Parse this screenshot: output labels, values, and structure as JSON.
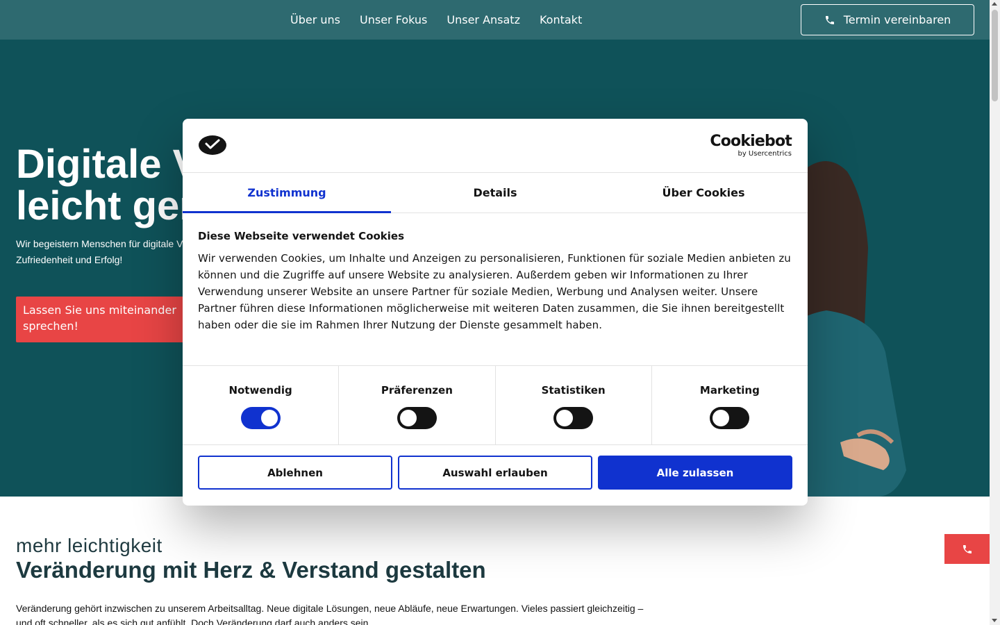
{
  "nav": {
    "items": [
      "Über uns",
      "Unser Fokus",
      "Unser Ansatz",
      "Kontakt"
    ],
    "cta": "Termin vereinbaren"
  },
  "hero": {
    "title": "Digitale V\nleicht gen",
    "subtitle": "Wir begeistern Menschen für digitale Ve\nZufriedenheit und Erfolg!",
    "button": "Lassen Sie uns miteinander sprechen!"
  },
  "section": {
    "kicker": "mehr leichtigkeit",
    "title": "Veränderung mit Herz & Verstand gestalten",
    "text": "Veränderung gehört inzwischen zu unserem Arbeitsalltag. Neue digitale Lösungen, neue Abläufe, neue Erwartungen. Vieles passiert gleichzeitig – und oft schneller, als es sich gut anfühlt. Doch Veränderung darf auch anders sein."
  },
  "cookie": {
    "brand": "Cookiebot",
    "brand_by": "by Usercentrics",
    "tabs": [
      "Zustimmung",
      "Details",
      "Über Cookies"
    ],
    "heading": "Diese Webseite verwendet Cookies",
    "body": "Wir verwenden Cookies, um Inhalte und Anzeigen zu personalisieren, Funktionen für soziale Medien anbieten zu können und die Zugriffe auf unsere Website zu analysieren. Außerdem geben wir Informationen zu Ihrer Verwendung unserer Website an unsere Partner für soziale Medien, Werbung und Analysen weiter. Unsere Partner führen diese Informationen möglicherweise mit weiteren Daten zusammen, die Sie ihnen bereitgestellt haben oder die sie im Rahmen Ihrer Nutzung der Dienste gesammelt haben.",
    "toggles": [
      {
        "label": "Notwendig",
        "on": true
      },
      {
        "label": "Präferenzen",
        "on": false
      },
      {
        "label": "Statistiken",
        "on": false
      },
      {
        "label": "Marketing",
        "on": false
      }
    ],
    "buttons": {
      "reject": "Ablehnen",
      "allow_selection": "Auswahl erlauben",
      "allow_all": "Alle zulassen"
    }
  },
  "colors": {
    "header_bg": "#2e6a70",
    "hero_bg": "#0f5259",
    "accent_red": "#e84545",
    "cookie_blue": "#1032cf"
  }
}
